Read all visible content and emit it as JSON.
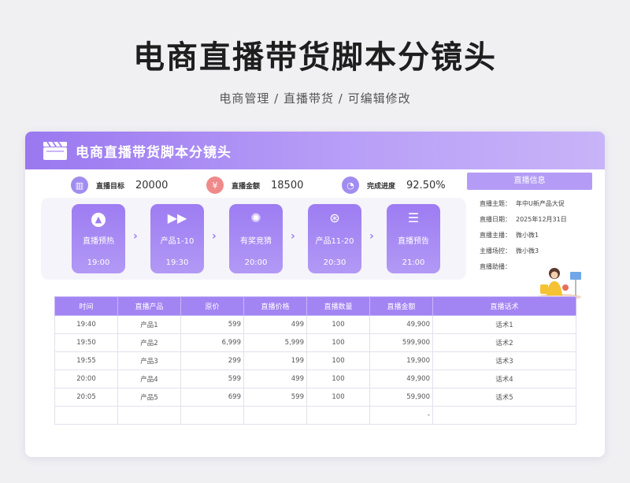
{
  "page": {
    "title": "电商直播带货脚本分镜头",
    "subtitle": "电商管理 / 直播带货 /  可编辑修改"
  },
  "card": {
    "header_title": "电商直播带货脚本分镜头",
    "stats": [
      {
        "label": "直播目标",
        "value": "20000",
        "icon": "building-icon",
        "color": "#a18cf0"
      },
      {
        "label": "直播金额",
        "value": "18500",
        "icon": "money-icon",
        "color": "#f08a8a"
      },
      {
        "label": "完成进度",
        "value": "92.50%",
        "icon": "progress-icon",
        "color": "#a18cf0"
      }
    ],
    "flow": [
      {
        "label": "直播预热",
        "time": "19:00",
        "icon": "upload-icon"
      },
      {
        "label": "产品1-10",
        "time": "19:30",
        "icon": "fast-forward-icon"
      },
      {
        "label": "有奖竞猜",
        "time": "20:00",
        "icon": "aperture-icon"
      },
      {
        "label": "产品11-20",
        "time": "20:30",
        "icon": "film-reel-icon"
      },
      {
        "label": "直播预告",
        "time": "21:00",
        "icon": "menu-icon"
      }
    ],
    "info": {
      "title": "直播信息",
      "rows": [
        {
          "key": "直播主题：",
          "value": "年中U新产品大促"
        },
        {
          "key": "直播日期：",
          "value": "2025年12月31日"
        },
        {
          "key": "直播主播：",
          "value": "微小微1"
        },
        {
          "key": "主播场控：",
          "value": "微小微3"
        },
        {
          "key": "直播助播：",
          "value": ""
        }
      ]
    },
    "table": {
      "headers": [
        "时间",
        "直播产品",
        "原价",
        "直播价格",
        "直播数量",
        "直播金额",
        "直播话术"
      ],
      "rows": [
        [
          "19:40",
          "产品1",
          "599",
          "499",
          "100",
          "49,900",
          "话术1"
        ],
        [
          "19:50",
          "产品2",
          "6,999",
          "5,999",
          "100",
          "599,900",
          "话术2"
        ],
        [
          "19:55",
          "产品3",
          "299",
          "199",
          "100",
          "19,900",
          "话术3"
        ],
        [
          "20:00",
          "产品4",
          "599",
          "499",
          "100",
          "49,900",
          "话术4"
        ],
        [
          "20:05",
          "产品5",
          "699",
          "599",
          "100",
          "59,900",
          "话术5"
        ],
        [
          "",
          "",
          "",
          "",
          "",
          "-",
          ""
        ]
      ]
    }
  }
}
